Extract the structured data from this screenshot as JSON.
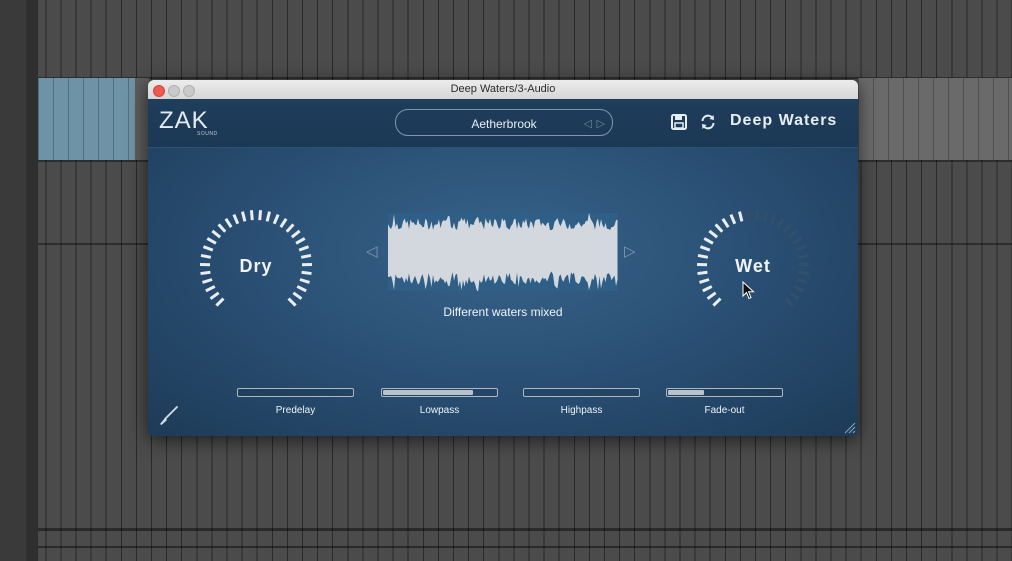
{
  "window": {
    "title": "Deep Waters/3-Audio"
  },
  "header": {
    "logo_main": "ZAK",
    "logo_sub": "SOUND",
    "preset_name": "Aetherbrook",
    "product_name": "Deep Waters",
    "icons": [
      "save-icon",
      "sync-icon",
      "prev-arrow-icon",
      "next-arrow-icon"
    ]
  },
  "knobs": {
    "dry": {
      "label": "Dry",
      "value": 1.0
    },
    "wet": {
      "label": "Wet",
      "value": 0.45
    }
  },
  "waveform": {
    "description": "Different waters mixed"
  },
  "sliders": [
    {
      "label": "Predelay",
      "value": 0.0
    },
    {
      "label": "Lowpass",
      "value": 0.8
    },
    {
      "label": "Highpass",
      "value": 0.0
    },
    {
      "label": "Fade-out",
      "value": 0.32
    }
  ],
  "colors": {
    "accent": "#e6edf3",
    "plugin_bg": "#2b5176",
    "header_bg": "#1f3e5c",
    "close_button": "#ee5a52"
  }
}
